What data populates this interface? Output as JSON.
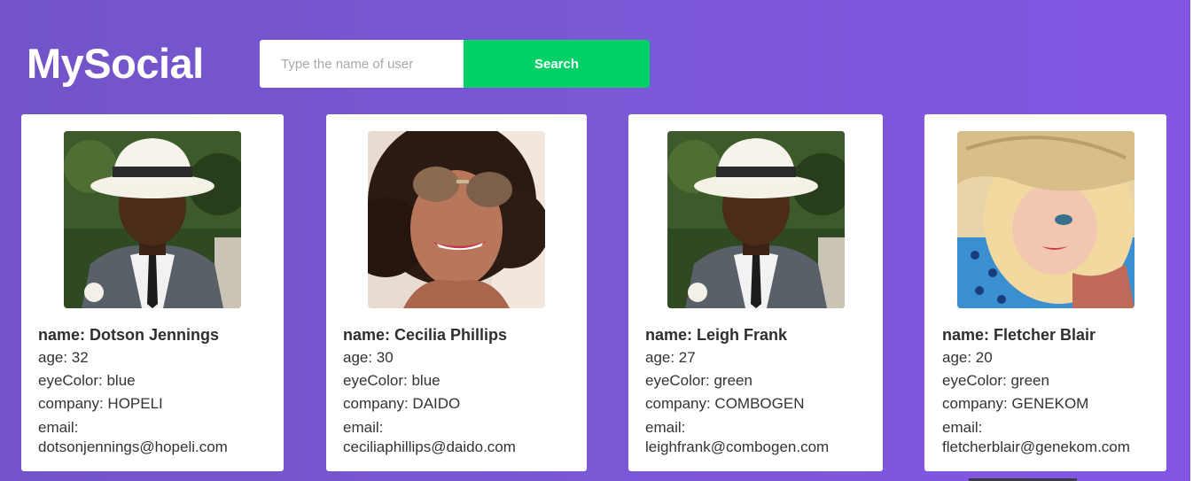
{
  "app": {
    "logo": "MySocial"
  },
  "search": {
    "placeholder": "Type the name of user",
    "value": "",
    "button_label": "Search"
  },
  "colors": {
    "background_start": "#7254c8",
    "background_end": "#8355e3",
    "search_button": "#00d166",
    "card": "#ffffff"
  },
  "users": [
    {
      "name": "name: Dotson Jennings",
      "age": "age: 32",
      "eyeColor": "eyeColor: blue",
      "company": "company: HOPELI",
      "email_label": "email:",
      "email": "dotsonjennings@hopeli.com",
      "photo": "man-in-white-fedora-photo"
    },
    {
      "name": "name: Cecilia Phillips",
      "age": "age: 30",
      "eyeColor": "eyeColor: blue",
      "company": "company: DAIDO",
      "email_label": "email:",
      "email": "ceciliaphillips@daido.com",
      "photo": "woman-with-aviator-sunglasses-photo"
    },
    {
      "name": "name: Leigh Frank",
      "age": "age: 27",
      "eyeColor": "eyeColor: green",
      "company": "company: COMBOGEN",
      "email_label": "email:",
      "email": "leighfrank@combogen.com",
      "photo": "man-in-white-fedora-photo"
    },
    {
      "name": "name: Fletcher Blair",
      "age": "age: 20",
      "eyeColor": "eyeColor: green",
      "company": "company: GENEKOM",
      "email_label": "email:",
      "email": "fletcherblair@genekom.com",
      "photo": "blonde-woman-in-straw-hat-photo"
    }
  ]
}
